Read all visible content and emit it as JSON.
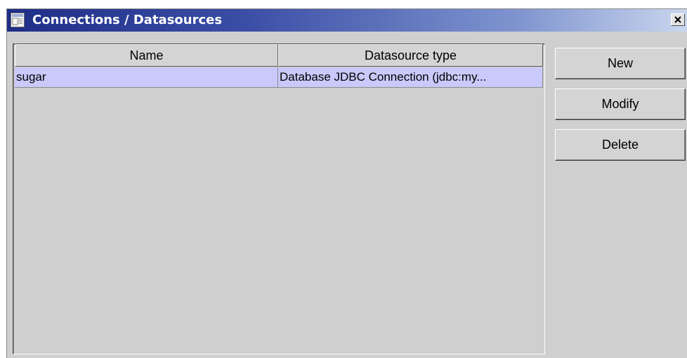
{
  "window": {
    "title": "Connections / Datasources",
    "title_icon": "document-window-icon",
    "close_label": "✕"
  },
  "table": {
    "columns": [
      "Name",
      "Datasource type"
    ],
    "rows": [
      {
        "name": "sugar",
        "type": "Database JDBC Connection (jdbc:my...",
        "selected": true
      }
    ]
  },
  "buttons": {
    "new": "New",
    "modify": "Modify",
    "delete": "Delete"
  },
  "colors": {
    "title_gradient_start": "#1f2e87",
    "title_gradient_end": "#c9d6ee",
    "selection": "#c9c9fb",
    "panel": "#cfcfcf"
  }
}
